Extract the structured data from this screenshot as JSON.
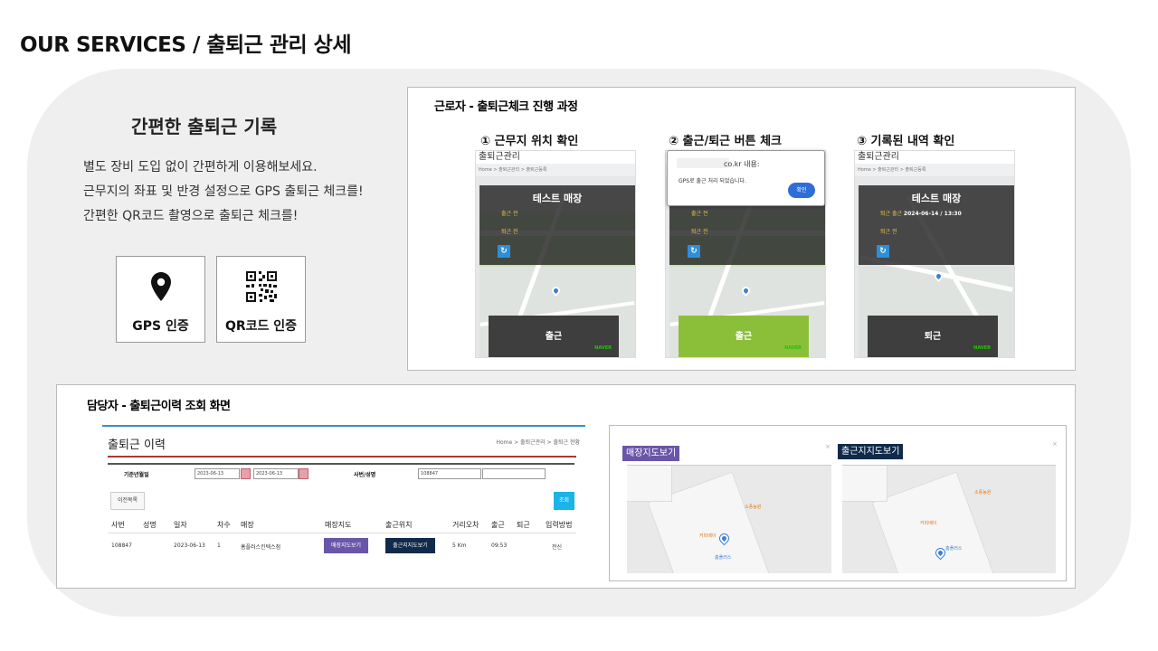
{
  "page": {
    "title": "OUR SERVICES / 출퇴근 관리 상세"
  },
  "intro": {
    "title": "간편한 출퇴근 기록",
    "lines": [
      "별도 장비 도입 없이 간편하게 이용해보세요.",
      "근무지의 좌표 및 반경 설정으로 GPS 출퇴근 체크를!",
      "간편한 QR코드 촬영으로 출퇴근 체크를!"
    ],
    "auth": [
      {
        "label": "GPS 인증",
        "icon": "map-pin-icon"
      },
      {
        "label": "QR코드 인증",
        "icon": "qr-code-icon"
      }
    ]
  },
  "worker": {
    "title": "근로자 - 출퇴근체크 진행 과정",
    "steps": [
      {
        "label": "① 근무지 위치 확인"
      },
      {
        "label": "② 출근/퇴근 버튼 체크"
      },
      {
        "label": "③ 기록된 내역 확인"
      }
    ],
    "phone": {
      "header": "출퇴근관리",
      "breadcrumb": "Home > 출퇴근관리 > 출퇴근등록",
      "store": "테스트 매장",
      "in_label": "출근 전",
      "out_label": "퇴근 전",
      "in_done": "퇴근 출근",
      "in_time": "2024-06-14 / 13:30",
      "btn_in": "출근",
      "btn_out": "퇴근",
      "naver": "NAVER",
      "naver_corp": "© NAVER Corp."
    },
    "dialog": {
      "title": "co.kr 내용:",
      "message": "GPS로 출근 처리 되었습니다.",
      "ok": "확인"
    }
  },
  "manager": {
    "title": "담당자 - 출퇴근이력 조회 화면",
    "history": {
      "title": "출퇴근 이력",
      "breadcrumb": "Home > 출퇴근관리 > 출퇴근 현황",
      "filter_date_label": "기준년월일",
      "date_from": "2023-06-13",
      "date_to": "2023-06-13",
      "emp_label": "사번/성명",
      "emp_value": "108847",
      "btn_prev": "이전목록",
      "btn_search": "조회",
      "columns": [
        "사번",
        "성명",
        "일자",
        "차수",
        "매장",
        "매장지도",
        "출근위치",
        "거리오차",
        "출근",
        "퇴근",
        "입력방법"
      ],
      "row": {
        "emp_no": "108847",
        "name": "",
        "date": "2023-06-13",
        "seq": "1",
        "store": "홈플러스킨텍스점",
        "store_map_btn": "매장지도보기",
        "checkin_map_btn": "출근지지도보기",
        "distance": "5  Km",
        "in_time": "09:53",
        "out_time": "",
        "method": "전신"
      }
    },
    "maps": {
      "store_label": "매장지도보기",
      "checkin_label": "출근지지도보기",
      "close": "×",
      "poi_1": "소풍농원",
      "poi_2": "커피베이",
      "poi_3": "홈플러스"
    }
  },
  "colors": {
    "accent_blue": "#2d8fd8",
    "check_green": "#8bbf3a",
    "store_map_btn": "#6a56a8",
    "checkin_map_btn": "#0f2a4a",
    "search_btn": "#19b4e8"
  }
}
